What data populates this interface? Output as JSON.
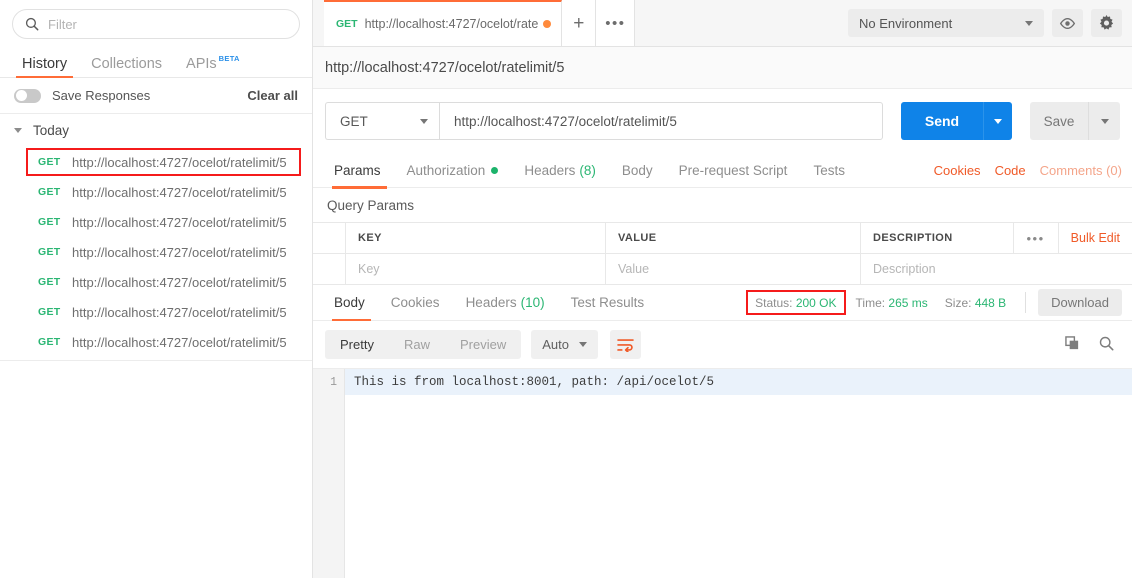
{
  "sidebar": {
    "filter": {
      "placeholder": "Filter",
      "value": ""
    },
    "nav_tabs": [
      {
        "label": "History",
        "active": true
      },
      {
        "label": "Collections",
        "active": false
      },
      {
        "label": "APIs",
        "active": false,
        "badge": "BETA"
      }
    ],
    "save_responses_label": "Save Responses",
    "save_responses_on": false,
    "clear_all_label": "Clear all",
    "group_label": "Today",
    "history": [
      {
        "method": "GET",
        "url": "http://localhost:4727/ocelot/ratelimit/5",
        "annotated": true
      },
      {
        "method": "GET",
        "url": "http://localhost:4727/ocelot/ratelimit/5",
        "annotated": false
      },
      {
        "method": "GET",
        "url": "http://localhost:4727/ocelot/ratelimit/5",
        "annotated": false
      },
      {
        "method": "GET",
        "url": "http://localhost:4727/ocelot/ratelimit/5",
        "annotated": false
      },
      {
        "method": "GET",
        "url": "http://localhost:4727/ocelot/ratelimit/5",
        "annotated": false
      },
      {
        "method": "GET",
        "url": "http://localhost:4727/ocelot/ratelimit/5",
        "annotated": false
      },
      {
        "method": "GET",
        "url": "http://localhost:4727/ocelot/ratelimit/5",
        "annotated": false
      }
    ]
  },
  "tabbar": {
    "tab": {
      "method": "GET",
      "url": "http://localhost:4727/ocelot/rate",
      "unsaved": true
    },
    "new_tab_label": "+",
    "more_label": "•••",
    "environment": {
      "value": "No Environment"
    }
  },
  "request": {
    "title": "http://localhost:4727/ocelot/ratelimit/5",
    "method": "GET",
    "url": "http://localhost:4727/ocelot/ratelimit/5",
    "send_label": "Send",
    "save_label": "Save",
    "tabs": [
      {
        "label": "Params",
        "active": true
      },
      {
        "label": "Authorization",
        "active": false,
        "dot": true
      },
      {
        "label": "Headers",
        "active": false,
        "count": "(8)"
      },
      {
        "label": "Body",
        "active": false
      },
      {
        "label": "Pre-request Script",
        "active": false
      },
      {
        "label": "Tests",
        "active": false
      }
    ],
    "right_links": [
      {
        "label": "Cookies",
        "muted": false
      },
      {
        "label": "Code",
        "muted": false
      },
      {
        "label": "Comments (0)",
        "muted": true
      }
    ],
    "query_params_label": "Query Params",
    "table": {
      "headers": [
        "KEY",
        "VALUE",
        "DESCRIPTION"
      ],
      "placeholders": [
        "Key",
        "Value",
        "Description"
      ],
      "dots_label": "•••",
      "bulk_edit_label": "Bulk Edit"
    }
  },
  "response": {
    "tabs": [
      {
        "label": "Body",
        "active": true
      },
      {
        "label": "Cookies",
        "active": false
      },
      {
        "label": "Headers",
        "active": false,
        "count": "(10)"
      },
      {
        "label": "Test Results",
        "active": false
      }
    ],
    "status_label": "Status:",
    "status_value": "200 OK",
    "time_label": "Time:",
    "time_value": "265 ms",
    "size_label": "Size:",
    "size_value": "448 B",
    "download_label": "Download",
    "view_modes": [
      {
        "label": "Pretty",
        "active": true
      },
      {
        "label": "Raw",
        "active": false
      },
      {
        "label": "Preview",
        "active": false
      }
    ],
    "format_select": "Auto",
    "line_number": "1",
    "body_text": "This is from localhost:8001, path: /api/ocelot/5"
  },
  "colors": {
    "accent_orange": "#ff6c37",
    "success_green": "#2bb673",
    "send_blue": "#0f83e8",
    "annotation_red": "#f51b1b"
  }
}
